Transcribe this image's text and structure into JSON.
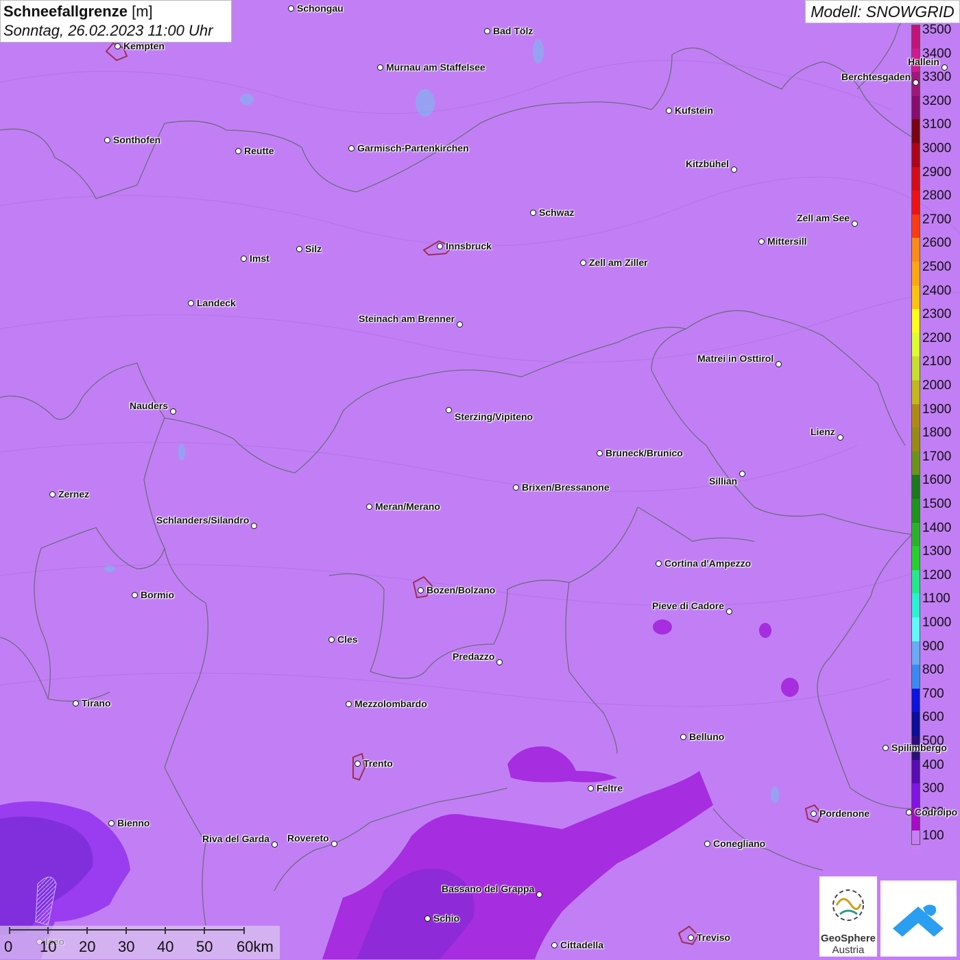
{
  "title": {
    "variable": "Schneefallgrenze",
    "unit": "[m]",
    "datetime": "Sonntag, 26.02.2023 11:00 Uhr"
  },
  "model": "Modell: SNOWGRID",
  "legend": {
    "ticks": [
      "3500",
      "3400",
      "3300",
      "3200",
      "3100",
      "3000",
      "2900",
      "2800",
      "2700",
      "2600",
      "2500",
      "2400",
      "2300",
      "2200",
      "2100",
      "2000",
      "1900",
      "1800",
      "1700",
      "1600",
      "1500",
      "1400",
      "1300",
      "1200",
      "1100",
      "1000",
      "900",
      "800",
      "700",
      "600",
      "500",
      "400",
      "300",
      "200",
      "100"
    ],
    "colors": [
      "#c5127a",
      "#d01a8f",
      "#a0167e",
      "#8a0c6e",
      "#7a0510",
      "#b00418",
      "#d80a14",
      "#f01212",
      "#ff3a10",
      "#ff8a14",
      "#ffa60e",
      "#ffc20c",
      "#ffff16",
      "#dcff2c",
      "#c6e02a",
      "#c4b818",
      "#b08a10",
      "#9a8a10",
      "#6a9418",
      "#187a18",
      "#1a961a",
      "#28b428",
      "#22d22a",
      "#22ea8a",
      "#28f2d2",
      "#60fafa",
      "#6aaaf6",
      "#3a8af2",
      "#0c12e2",
      "#0a0e9a",
      "#2c0e78",
      "#5a0ab6",
      "#8212e6",
      "#a80ac8",
      "#c77ff5"
    ]
  },
  "cities": [
    {
      "name": "Schongau"
    },
    {
      "name": "Bad Tölz"
    },
    {
      "name": "Kempten"
    },
    {
      "name": "Murnau am Staffelsee"
    },
    {
      "name": "Hallein"
    },
    {
      "name": "Berchtesgaden"
    },
    {
      "name": "Kufstein"
    },
    {
      "name": "Sonthofen"
    },
    {
      "name": "Reutte"
    },
    {
      "name": "Garmisch-Partenkirchen"
    },
    {
      "name": "Kitzbühel"
    },
    {
      "name": "Schwaz"
    },
    {
      "name": "Zell am See"
    },
    {
      "name": "Innsbruck"
    },
    {
      "name": "Mittersill"
    },
    {
      "name": "Imst"
    },
    {
      "name": "Silz"
    },
    {
      "name": "Zell am Ziller"
    },
    {
      "name": "Landeck"
    },
    {
      "name": "Steinach am Brenner"
    },
    {
      "name": "Matrei in Osttirol"
    },
    {
      "name": "Nauders"
    },
    {
      "name": "Sterzing/Vipiteno"
    },
    {
      "name": "Lienz"
    },
    {
      "name": "Bruneck/Brunico"
    },
    {
      "name": "Sillian"
    },
    {
      "name": "Brixen/Bressanone"
    },
    {
      "name": "Zernez"
    },
    {
      "name": "Meran/Merano"
    },
    {
      "name": "Schlanders/Silandro"
    },
    {
      "name": "Cortina d'Ampezzo"
    },
    {
      "name": "Bormio"
    },
    {
      "name": "Bozen/Bolzano"
    },
    {
      "name": "Pieve di Cadore"
    },
    {
      "name": "Cles"
    },
    {
      "name": "Predazzo"
    },
    {
      "name": "Tirano"
    },
    {
      "name": "Mezzolombardo"
    },
    {
      "name": "Belluno"
    },
    {
      "name": "Spilimbergo"
    },
    {
      "name": "Trento"
    },
    {
      "name": "Feltre"
    },
    {
      "name": "Pordenone"
    },
    {
      "name": "Codroipo"
    },
    {
      "name": "Bienno"
    },
    {
      "name": "Riva del Garda"
    },
    {
      "name": "Rovereto"
    },
    {
      "name": "Conegliano"
    },
    {
      "name": "Bassano del Grappa"
    },
    {
      "name": "Schio"
    },
    {
      "name": "Iseo"
    },
    {
      "name": "Treviso"
    },
    {
      "name": "Cittadella"
    }
  ],
  "scalebar": {
    "labels": [
      "0",
      "10",
      "20",
      "30",
      "40",
      "50",
      "60km"
    ]
  },
  "logo": {
    "name_line1": "GeoSphere",
    "name_line2": "Austria"
  }
}
